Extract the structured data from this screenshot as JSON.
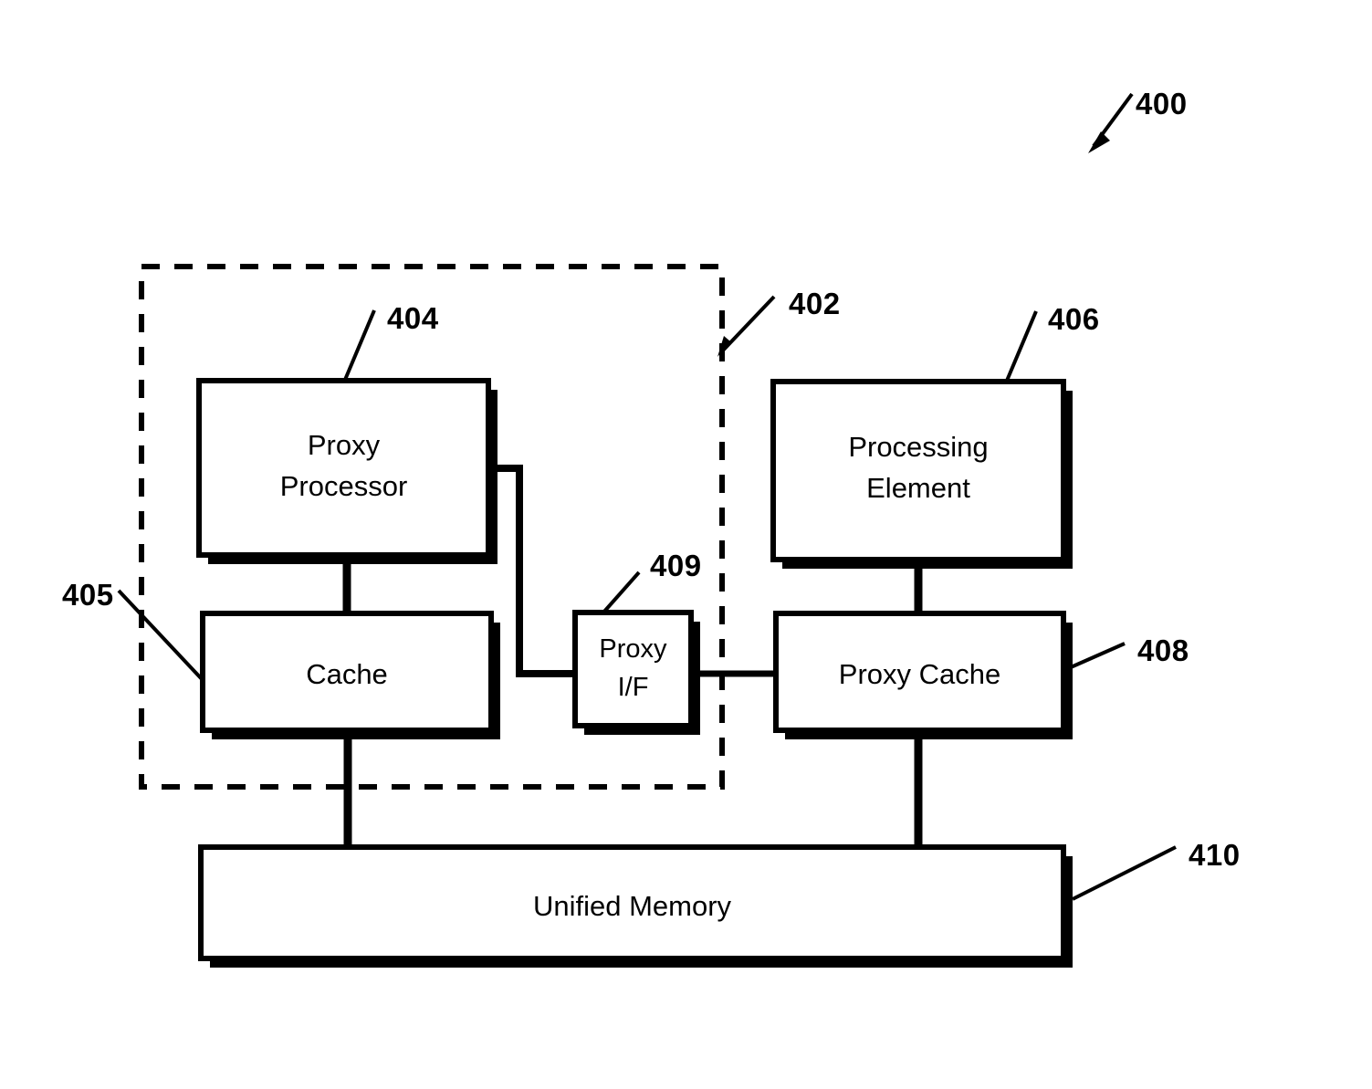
{
  "figure": {
    "number": "400",
    "type": "patent-block-diagram"
  },
  "reference_numerals": {
    "figure": "400",
    "system_boundary": "402",
    "proxy_processor": "404",
    "cache": "405",
    "processing_element": "406",
    "proxy_cache": "408",
    "proxy_interface": "409",
    "unified_memory": "410"
  },
  "blocks": {
    "proxy_processor": {
      "label": "Proxy\nProcessor"
    },
    "cache": {
      "label": "Cache"
    },
    "proxy_interface": {
      "label": "Proxy\nI/F"
    },
    "processing_element": {
      "label": "Processing\nElement"
    },
    "proxy_cache": {
      "label": "Proxy Cache"
    },
    "unified_memory": {
      "label": "Unified Memory"
    }
  },
  "colors": {
    "stroke": "#000000",
    "fill": "#ffffff",
    "shadow": "#000000",
    "background": "#ffffff"
  }
}
